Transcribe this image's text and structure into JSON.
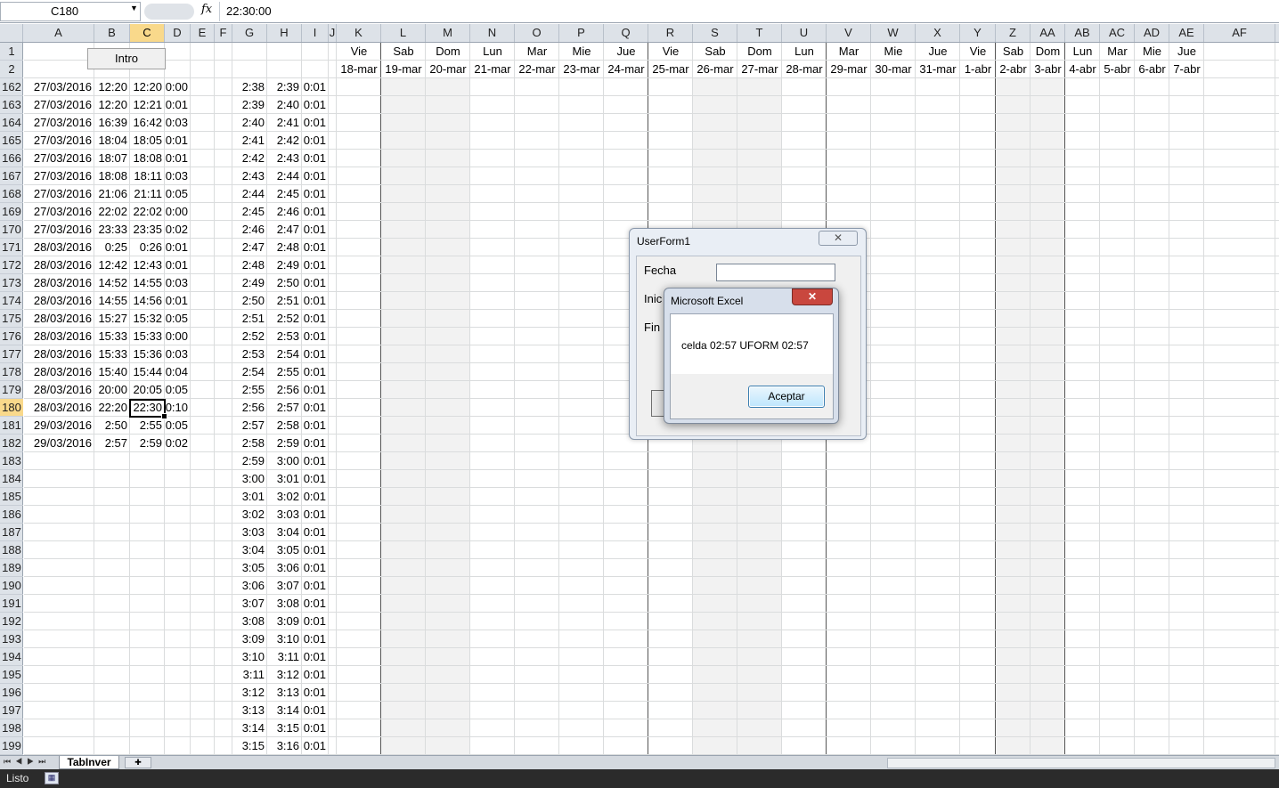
{
  "formula_bar": {
    "name_box": "C180",
    "fx": "fx",
    "value": "22:30:00"
  },
  "columns": [
    "A",
    "B",
    "C",
    "D",
    "E",
    "F",
    "G",
    "H",
    "I",
    "J",
    "K",
    "L",
    "M",
    "N",
    "O",
    "P",
    "Q",
    "R",
    "S",
    "T",
    "U",
    "V",
    "W",
    "X",
    "Y",
    "Z",
    "AA",
    "AB",
    "AC",
    "AD",
    "AE",
    "AF"
  ],
  "selected_column": "C",
  "intro_button": "Intro",
  "day_headers": [
    {
      "day": "Vie",
      "date": "18-mar"
    },
    {
      "day": "Sab",
      "date": "19-mar"
    },
    {
      "day": "Dom",
      "date": "20-mar"
    },
    {
      "day": "Lun",
      "date": "21-mar"
    },
    {
      "day": "Mar",
      "date": "22-mar"
    },
    {
      "day": "Mie",
      "date": "23-mar"
    },
    {
      "day": "Jue",
      "date": "24-mar"
    },
    {
      "day": "Vie",
      "date": "25-mar"
    },
    {
      "day": "Sab",
      "date": "26-mar"
    },
    {
      "day": "Dom",
      "date": "27-mar"
    },
    {
      "day": "Lun",
      "date": "28-mar"
    },
    {
      "day": "Mar",
      "date": "29-mar"
    },
    {
      "day": "Mie",
      "date": "30-mar"
    },
    {
      "day": "Jue",
      "date": "31-mar"
    },
    {
      "day": "Vie",
      "date": "1-abr"
    },
    {
      "day": "Sab",
      "date": "2-abr"
    },
    {
      "day": "Dom",
      "date": "3-abr"
    },
    {
      "day": "Lun",
      "date": "4-abr"
    },
    {
      "day": "Mar",
      "date": "5-abr"
    },
    {
      "day": "Mie",
      "date": "6-abr"
    },
    {
      "day": "Jue",
      "date": "7-abr"
    }
  ],
  "top_rows": [
    "1",
    "2"
  ],
  "rows": [
    {
      "n": "162",
      "a": "27/03/2016",
      "b": "12:20",
      "c": "12:20",
      "d": "0:00",
      "g": "2:38",
      "h": "2:39",
      "i": "0:01"
    },
    {
      "n": "163",
      "a": "27/03/2016",
      "b": "12:20",
      "c": "12:21",
      "d": "0:01",
      "g": "2:39",
      "h": "2:40",
      "i": "0:01"
    },
    {
      "n": "164",
      "a": "27/03/2016",
      "b": "16:39",
      "c": "16:42",
      "d": "0:03",
      "g": "2:40",
      "h": "2:41",
      "i": "0:01"
    },
    {
      "n": "165",
      "a": "27/03/2016",
      "b": "18:04",
      "c": "18:05",
      "d": "0:01",
      "g": "2:41",
      "h": "2:42",
      "i": "0:01"
    },
    {
      "n": "166",
      "a": "27/03/2016",
      "b": "18:07",
      "c": "18:08",
      "d": "0:01",
      "g": "2:42",
      "h": "2:43",
      "i": "0:01"
    },
    {
      "n": "167",
      "a": "27/03/2016",
      "b": "18:08",
      "c": "18:11",
      "d": "0:03",
      "g": "2:43",
      "h": "2:44",
      "i": "0:01"
    },
    {
      "n": "168",
      "a": "27/03/2016",
      "b": "21:06",
      "c": "21:11",
      "d": "0:05",
      "g": "2:44",
      "h": "2:45",
      "i": "0:01"
    },
    {
      "n": "169",
      "a": "27/03/2016",
      "b": "22:02",
      "c": "22:02",
      "d": "0:00",
      "g": "2:45",
      "h": "2:46",
      "i": "0:01"
    },
    {
      "n": "170",
      "a": "27/03/2016",
      "b": "23:33",
      "c": "23:35",
      "d": "0:02",
      "g": "2:46",
      "h": "2:47",
      "i": "0:01"
    },
    {
      "n": "171",
      "a": "28/03/2016",
      "b": "0:25",
      "c": "0:26",
      "d": "0:01",
      "g": "2:47",
      "h": "2:48",
      "i": "0:01"
    },
    {
      "n": "172",
      "a": "28/03/2016",
      "b": "12:42",
      "c": "12:43",
      "d": "0:01",
      "g": "2:48",
      "h": "2:49",
      "i": "0:01"
    },
    {
      "n": "173",
      "a": "28/03/2016",
      "b": "14:52",
      "c": "14:55",
      "d": "0:03",
      "g": "2:49",
      "h": "2:50",
      "i": "0:01"
    },
    {
      "n": "174",
      "a": "28/03/2016",
      "b": "14:55",
      "c": "14:56",
      "d": "0:01",
      "g": "2:50",
      "h": "2:51",
      "i": "0:01"
    },
    {
      "n": "175",
      "a": "28/03/2016",
      "b": "15:27",
      "c": "15:32",
      "d": "0:05",
      "g": "2:51",
      "h": "2:52",
      "i": "0:01"
    },
    {
      "n": "176",
      "a": "28/03/2016",
      "b": "15:33",
      "c": "15:33",
      "d": "0:00",
      "g": "2:52",
      "h": "2:53",
      "i": "0:01"
    },
    {
      "n": "177",
      "a": "28/03/2016",
      "b": "15:33",
      "c": "15:36",
      "d": "0:03",
      "g": "2:53",
      "h": "2:54",
      "i": "0:01"
    },
    {
      "n": "178",
      "a": "28/03/2016",
      "b": "15:40",
      "c": "15:44",
      "d": "0:04",
      "g": "2:54",
      "h": "2:55",
      "i": "0:01"
    },
    {
      "n": "179",
      "a": "28/03/2016",
      "b": "20:00",
      "c": "20:05",
      "d": "0:05",
      "g": "2:55",
      "h": "2:56",
      "i": "0:01"
    },
    {
      "n": "180",
      "a": "28/03/2016",
      "b": "22:20",
      "c": "22:30",
      "d": "0:10",
      "g": "2:56",
      "h": "2:57",
      "i": "0:01",
      "selected": true
    },
    {
      "n": "181",
      "a": "29/03/2016",
      "b": "2:50",
      "c": "2:55",
      "d": "0:05",
      "g": "2:57",
      "h": "2:58",
      "i": "0:01"
    },
    {
      "n": "182",
      "a": "29/03/2016",
      "b": "2:57",
      "c": "2:59",
      "d": "0:02",
      "g": "2:58",
      "h": "2:59",
      "i": "0:01"
    },
    {
      "n": "183",
      "a": "",
      "b": "",
      "c": "",
      "d": "",
      "g": "2:59",
      "h": "3:00",
      "i": "0:01"
    },
    {
      "n": "184",
      "a": "",
      "b": "",
      "c": "",
      "d": "",
      "g": "3:00",
      "h": "3:01",
      "i": "0:01"
    },
    {
      "n": "185",
      "a": "",
      "b": "",
      "c": "",
      "d": "",
      "g": "3:01",
      "h": "3:02",
      "i": "0:01"
    },
    {
      "n": "186",
      "a": "",
      "b": "",
      "c": "",
      "d": "",
      "g": "3:02",
      "h": "3:03",
      "i": "0:01"
    },
    {
      "n": "187",
      "a": "",
      "b": "",
      "c": "",
      "d": "",
      "g": "3:03",
      "h": "3:04",
      "i": "0:01"
    },
    {
      "n": "188",
      "a": "",
      "b": "",
      "c": "",
      "d": "",
      "g": "3:04",
      "h": "3:05",
      "i": "0:01"
    },
    {
      "n": "189",
      "a": "",
      "b": "",
      "c": "",
      "d": "",
      "g": "3:05",
      "h": "3:06",
      "i": "0:01"
    },
    {
      "n": "190",
      "a": "",
      "b": "",
      "c": "",
      "d": "",
      "g": "3:06",
      "h": "3:07",
      "i": "0:01"
    },
    {
      "n": "191",
      "a": "",
      "b": "",
      "c": "",
      "d": "",
      "g": "3:07",
      "h": "3:08",
      "i": "0:01"
    },
    {
      "n": "192",
      "a": "",
      "b": "",
      "c": "",
      "d": "",
      "g": "3:08",
      "h": "3:09",
      "i": "0:01"
    },
    {
      "n": "193",
      "a": "",
      "b": "",
      "c": "",
      "d": "",
      "g": "3:09",
      "h": "3:10",
      "i": "0:01"
    },
    {
      "n": "194",
      "a": "",
      "b": "",
      "c": "",
      "d": "",
      "g": "3:10",
      "h": "3:11",
      "i": "0:01"
    },
    {
      "n": "195",
      "a": "",
      "b": "",
      "c": "",
      "d": "",
      "g": "3:11",
      "h": "3:12",
      "i": "0:01"
    },
    {
      "n": "196",
      "a": "",
      "b": "",
      "c": "",
      "d": "",
      "g": "3:12",
      "h": "3:13",
      "i": "0:01"
    },
    {
      "n": "197",
      "a": "",
      "b": "",
      "c": "",
      "d": "",
      "g": "3:13",
      "h": "3:14",
      "i": "0:01"
    },
    {
      "n": "198",
      "a": "",
      "b": "",
      "c": "",
      "d": "",
      "g": "3:14",
      "h": "3:15",
      "i": "0:01"
    },
    {
      "n": "199",
      "a": "",
      "b": "",
      "c": "",
      "d": "",
      "g": "3:15",
      "h": "3:16",
      "i": "0:01"
    }
  ],
  "userform": {
    "title": "UserForm1",
    "close": "✕",
    "fecha_label": "Fecha",
    "inicio_label": "Inic",
    "fin_label": "Fin"
  },
  "msgbox": {
    "title": "Microsoft Excel",
    "close": "✕",
    "message": "celda 02:57 UFORM 02:57",
    "ok": "Aceptar"
  },
  "sheet_tab": "TabInver",
  "status": {
    "text": "Listo"
  },
  "colors": {
    "selected_header": "#f9d98b",
    "weekend_shade": "#f2f2f2",
    "msgbox_close": "#c9473e"
  }
}
